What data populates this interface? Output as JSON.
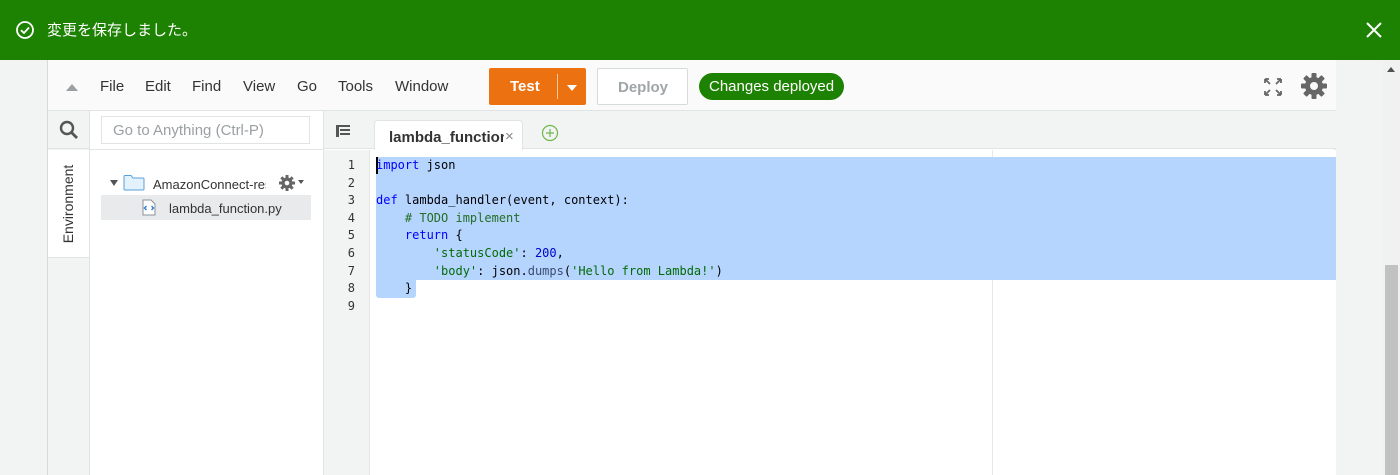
{
  "notification": {
    "message": "変更を保存しました。",
    "background": "#1d8102"
  },
  "menubar": {
    "items": [
      "File",
      "Edit",
      "Find",
      "View",
      "Go",
      "Tools",
      "Window"
    ],
    "test_label": "Test",
    "deploy_label": "Deploy",
    "status_badge": "Changes deployed",
    "accent": "#ec7211"
  },
  "sidebar": {
    "environment_tab": "Environment",
    "goto_placeholder": "Go to Anything (Ctrl-P)",
    "tree": {
      "folder": "AmazonConnect-res",
      "file": "lambda_function.py"
    }
  },
  "editor": {
    "tab_label": "lambda_function",
    "tab_close": "×",
    "line_numbers": [
      "1",
      "2",
      "3",
      "4",
      "5",
      "6",
      "7",
      "8",
      "9"
    ],
    "code": {
      "l1_kw": "import",
      "l1_rest": " json",
      "l3_kw": "def",
      "l3_rest": " lambda_handler(event, context):",
      "l4_comment": "    # TODO implement",
      "l5_kw": "    return",
      "l5_rest": " {",
      "l6_indent": "        ",
      "l6_key": "'statusCode'",
      "l6_sep": ": ",
      "l6_num": "200",
      "l6_end": ",",
      "l7_indent": "        ",
      "l7_key": "'body'",
      "l7_sep": ": json.",
      "l7_fn": "dumps",
      "l7_open": "(",
      "l7_str": "'Hello from Lambda!'",
      "l7_close": ")",
      "l8": "    }"
    }
  }
}
